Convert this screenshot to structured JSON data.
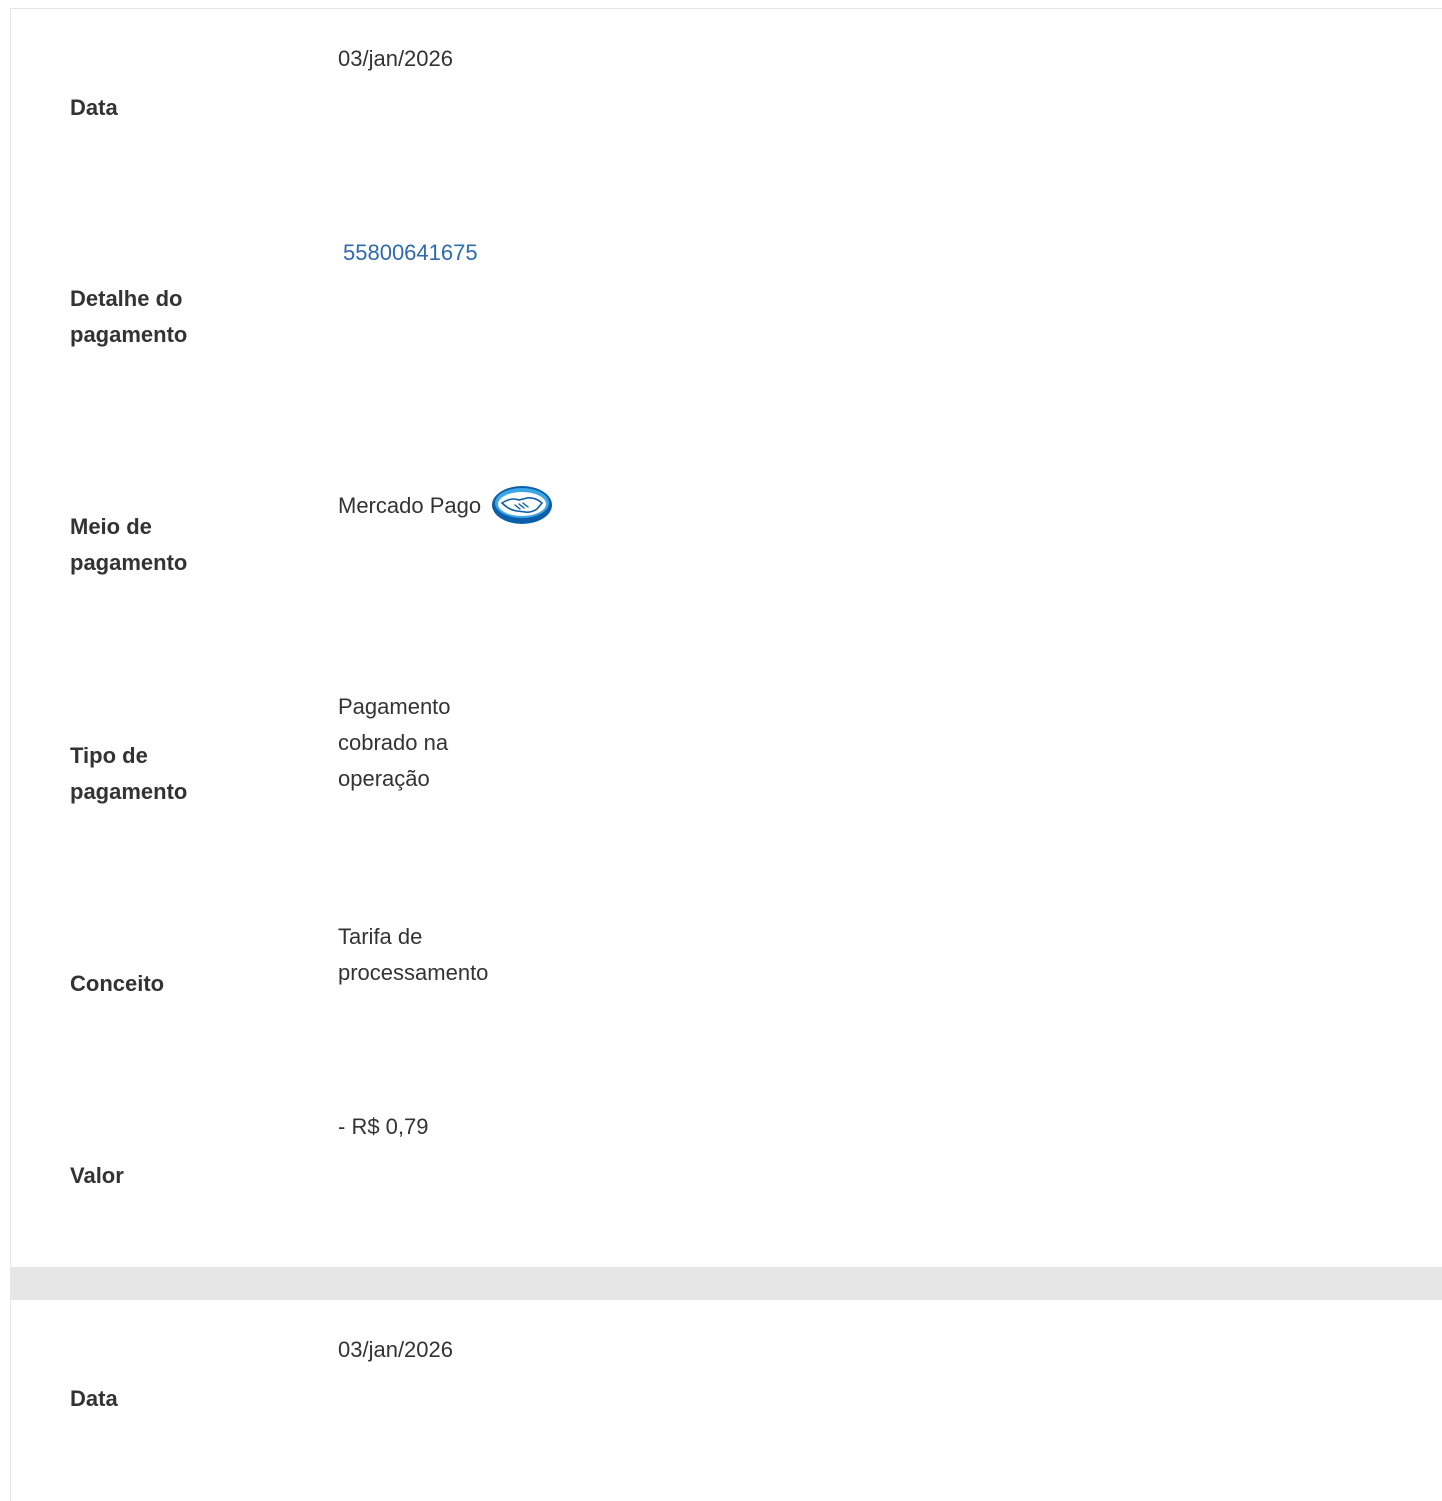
{
  "entries": [
    {
      "date": {
        "label": "Data",
        "value": "03/jan/2026"
      },
      "payment_detail": {
        "label": "Detalhe do pagamento",
        "value": "55800641675"
      },
      "payment_method": {
        "label": "Meio de pagamento",
        "value": "Mercado Pago",
        "icon": "mercado-pago-handshake-icon"
      },
      "payment_type": {
        "label": "Tipo de pagamento",
        "value": "Pagamento cobrado na operação"
      },
      "concept": {
        "label": "Conceito",
        "value": "Tarifa de processamento"
      },
      "amount": {
        "label": "Valor",
        "value": "- R$ 0,79"
      }
    },
    {
      "date": {
        "label": "Data",
        "value": "03/jan/2026"
      }
    }
  ],
  "colors": {
    "link": "#2d6ab0",
    "separator": "#e6e6e6",
    "logo_blue": "#0a5fa8",
    "logo_light": "#3ba7e6"
  }
}
